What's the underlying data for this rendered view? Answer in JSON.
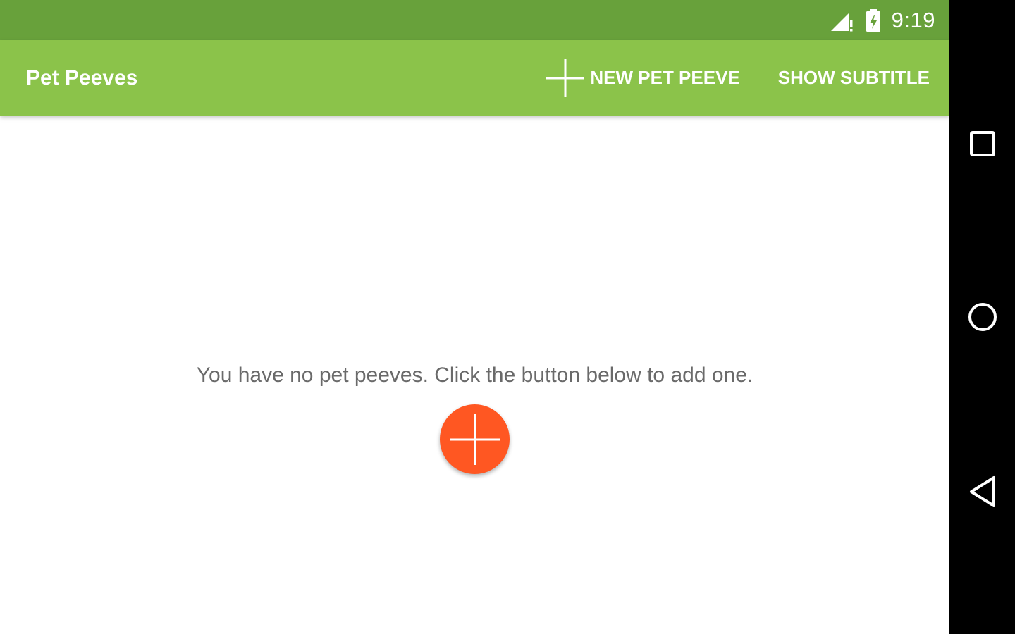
{
  "status_bar": {
    "time": "9:19",
    "icons": [
      "signal-icon",
      "battery-icon"
    ],
    "color": "#68a13b"
  },
  "app_bar": {
    "title": "Pet Peeves",
    "color": "#8bc34a",
    "actions": {
      "new_pet_peeve": {
        "label": "NEW PET PEEVE",
        "icon": "plus-icon"
      },
      "show_subtitle": {
        "label": "SHOW SUBTITLE"
      }
    }
  },
  "content": {
    "empty_message": "You have no pet peeves. Click the button below to add one.",
    "fab": {
      "icon": "plus-icon",
      "color": "#ff5722"
    }
  },
  "nav_bar": {
    "buttons": [
      "recents-icon",
      "home-icon",
      "back-icon"
    ]
  }
}
